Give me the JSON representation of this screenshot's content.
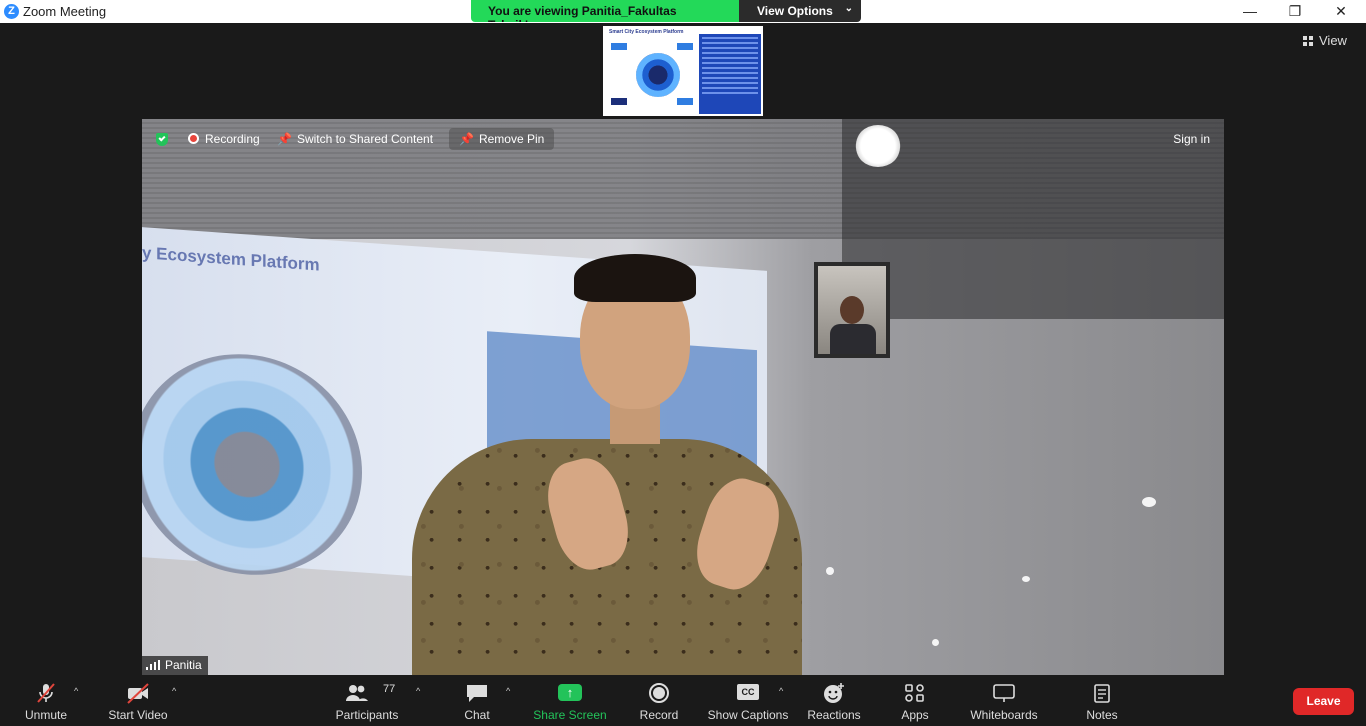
{
  "window": {
    "title": "Zoom Meeting",
    "logo_letter": "Z",
    "minimize": "—",
    "restore": "❐",
    "close": "✕"
  },
  "banner": {
    "message": "You are viewing Panitia_Fakultas Teknik's screen",
    "view_options": "View Options",
    "chevron": "⌄"
  },
  "thumbnail": {
    "title": "Smart City Ecosystem Platform"
  },
  "view_button": {
    "label": "View"
  },
  "video_toolbar": {
    "recording": "Recording",
    "switch_shared": "Switch to Shared Content",
    "remove_pin": "Remove Pin",
    "sign_in": "Sign in",
    "pin_glyph": "📌"
  },
  "slide": {
    "title": "y Ecosystem Platform"
  },
  "participant_name": "Panitia",
  "toolbar": {
    "unmute": "Unmute",
    "start_video": "Start Video",
    "participants": "Participants",
    "participants_count": "77",
    "chat": "Chat",
    "share_screen": "Share Screen",
    "record": "Record",
    "show_captions": "Show Captions",
    "reactions": "Reactions",
    "apps": "Apps",
    "whiteboards": "Whiteboards",
    "notes": "Notes",
    "leave": "Leave",
    "caret": "^",
    "cc": "CC",
    "share_arrow": "↑"
  },
  "colors": {
    "share_green": "#23c35a",
    "leave_red": "#e02828",
    "banner_green": "#23d959"
  }
}
